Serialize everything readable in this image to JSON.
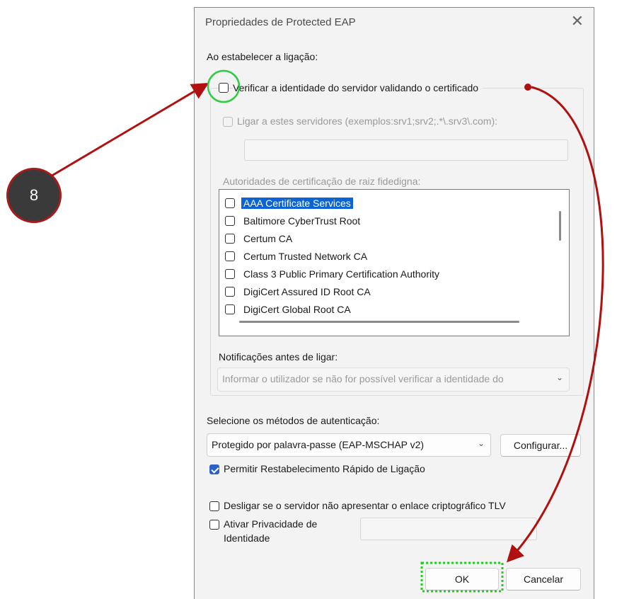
{
  "dialog": {
    "title": "Propriedades de Protected EAP",
    "close_glyph": "✕"
  },
  "connection": {
    "heading": "Ao estabelecer a ligação:",
    "verify_server_label": "Verificar a identidade do servidor validando o certificado",
    "verify_server_checked": false,
    "connect_servers_label": "Ligar a estes servidores (exemplos:srv1;srv2;.*\\.srv3\\.com):",
    "connect_servers_value": "",
    "trusted_root_label": "Autoridades de certificação de raiz fidedigna:",
    "certificates": [
      {
        "name": "AAA Certificate Services",
        "checked": false,
        "selected": true
      },
      {
        "name": "Baltimore CyberTrust Root",
        "checked": false,
        "selected": false
      },
      {
        "name": "Certum CA",
        "checked": false,
        "selected": false
      },
      {
        "name": "Certum Trusted Network CA",
        "checked": false,
        "selected": false
      },
      {
        "name": "Class 3 Public Primary Certification Authority",
        "checked": false,
        "selected": false
      },
      {
        "name": "DigiCert Assured ID Root CA",
        "checked": false,
        "selected": false
      },
      {
        "name": "DigiCert Global Root CA",
        "checked": false,
        "selected": false
      }
    ],
    "notifications_label": "Notificações antes de ligar:",
    "notifications_value": "Informar o utilizador se não for possível verificar a identidade do"
  },
  "auth": {
    "heading": "Selecione os métodos de autenticação:",
    "method_value": "Protegido por palavra-passe (EAP-MSCHAP v2)",
    "configure_button": "Configurar...",
    "fast_reconnect_label": "Permitir Restabelecimento Rápido de Ligação",
    "fast_reconnect_checked": true,
    "disconnect_tlv_label": "Desligar se o servidor não apresentar o enlace criptográfico TLV",
    "disconnect_tlv_checked": false,
    "identity_privacy_label_1": "Ativar Privacidade de",
    "identity_privacy_label_2": "Identidade",
    "identity_privacy_checked": false,
    "identity_value": ""
  },
  "footer": {
    "ok_button": "OK",
    "cancel_button": "Cancelar"
  },
  "annotation": {
    "step_number": "8",
    "arrow_color": "#b01010",
    "highlight_color": "#22cc22"
  }
}
